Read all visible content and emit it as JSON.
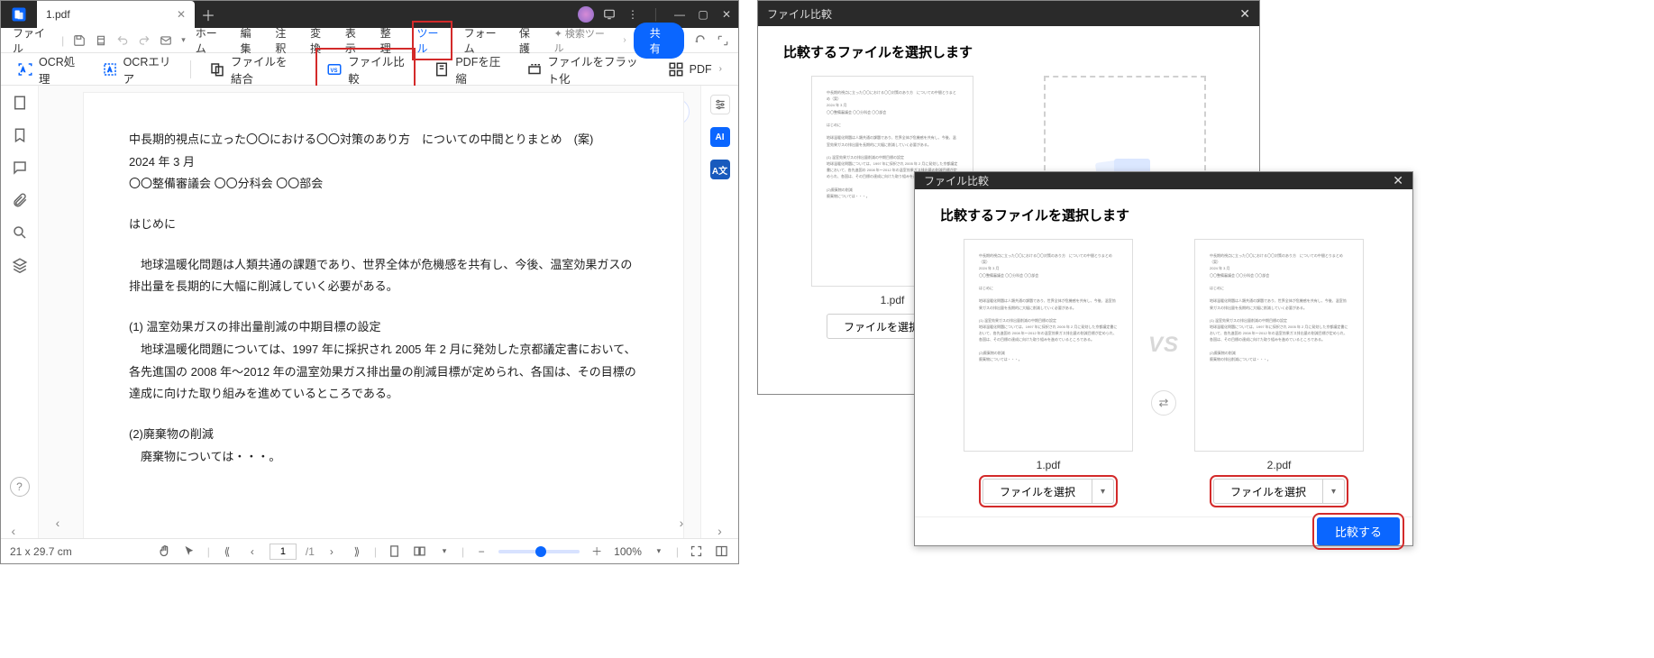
{
  "title_tab": "1.pdf",
  "menu": {
    "file": "ファイル",
    "home": "ホーム",
    "edit": "編集",
    "annotate": "注釈",
    "convert": "変換",
    "view": "表示",
    "organize": "整理",
    "tools": "ツール",
    "form": "フォーム",
    "protect": "保護",
    "search": "検索ツール",
    "share": "共有"
  },
  "toolbar": {
    "ocr": "OCR処理",
    "ocr_area": "OCRエリア",
    "merge": "ファイルを結合",
    "compare": "ファイル比較",
    "compress": "PDFを圧縮",
    "flatten": "ファイルをフラット化",
    "pdf_more": "PDF"
  },
  "doc": {
    "p1": "中長期的視点に立った〇〇における〇〇対策のあり方　についての中間とりまとめ　(案)",
    "p2": "2024 年 3 月",
    "p3": "〇〇整備審議会 〇〇分科会 〇〇部会",
    "p4": "はじめに",
    "p5": "　地球温暖化問題は人類共通の課題であり、世界全体が危機感を共有し、今後、温室効果ガスの排出量を長期的に大幅に削減していく必要がある。",
    "p6": "(1) 温室効果ガスの排出量削減の中期目標の設定",
    "p7": "　地球温暖化問題については、1997 年に採択され 2005 年 2 月に発効した京都議定書において、各先進国の 2008 年～2012 年の温室効果ガス排出量の削減目標が定められ、各国は、その目標の達成に向けた取り組みを進めているところである。",
    "p8": "(2)廃棄物の削減",
    "p9": "　廃棄物については・・・。"
  },
  "status": {
    "dims": "21 x 29.7 cm",
    "page_cur": "1",
    "page_total": "/1",
    "zoom": "100%"
  },
  "modal": {
    "win_title": "ファイル比較",
    "heading": "比較するファイルを選択します",
    "file1": "1.pdf",
    "file2": "2.pdf",
    "choose": "ファイルを選択",
    "vs": "VS",
    "run": "比較する"
  }
}
